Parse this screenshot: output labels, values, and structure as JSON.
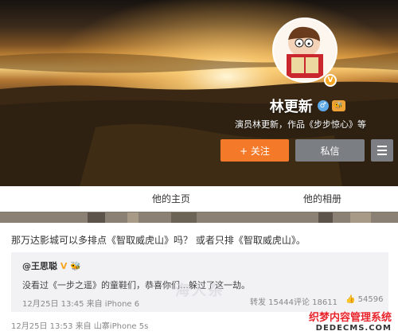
{
  "profile": {
    "name": "林更新",
    "gender_symbol": "♂",
    "level_badge": "🐝",
    "verified_symbol": "V",
    "description": "演员林更新，作品《步步惊心》等",
    "follow_label": "+ 关注",
    "message_label": "私信"
  },
  "tabs": [
    {
      "label": "他的主页"
    },
    {
      "label": "他的相册"
    }
  ],
  "post": {
    "text": "那万达影城可以多排点《智取威虎山》吗？ 或者只排《智取威虎山》。",
    "repost": {
      "user": "@王思聪",
      "user_badges": "V 🐝",
      "text": "没看过《一步之遥》的童鞋们，恭喜你们…躲过了这一劫。",
      "time": "12月25日 13:45 来自 iPhone 6",
      "share_label": "转发 15444",
      "comment_label": "评论 18611",
      "like_label": "54596"
    },
    "time": "12月25日 13:53 来自 山寨iPhone 5s"
  },
  "watermarks": {
    "overlay_text": "海人杂",
    "site_name": "织梦内容管理系统",
    "site_url": "DEDECMS.COM"
  },
  "colors": {
    "follow_button": "#f47a2a",
    "secondary_button": "#7b7e82",
    "gender_badge": "#5fa8e6"
  }
}
